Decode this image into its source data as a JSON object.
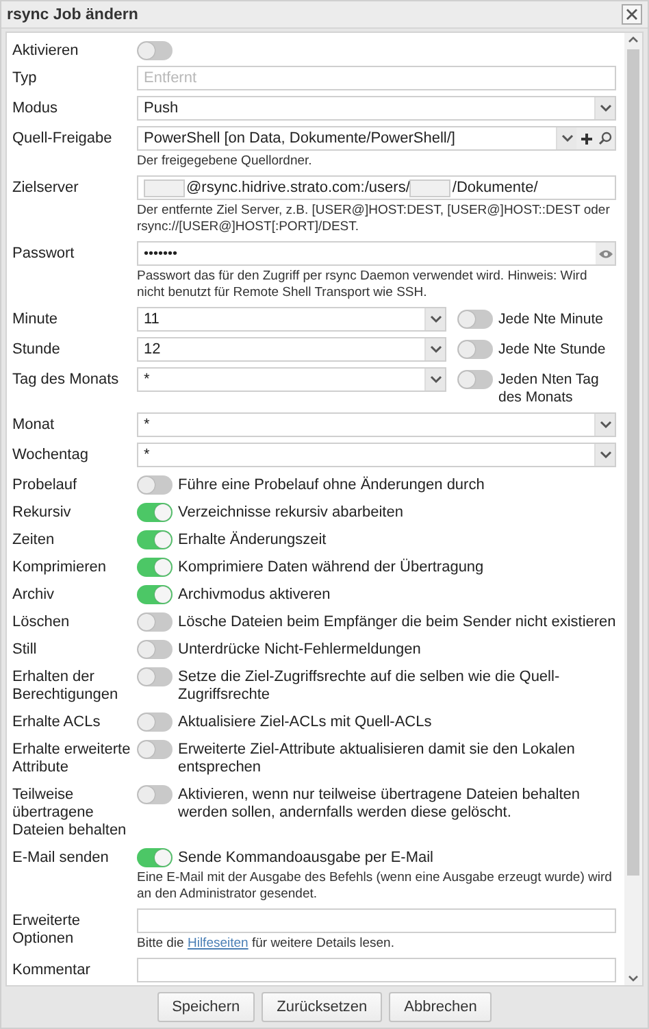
{
  "window": {
    "title": "rsync Job ändern"
  },
  "fields": [
    {
      "label": "Aktivieren",
      "kind": "toggle",
      "on": false
    },
    {
      "label": "Typ",
      "kind": "text",
      "placeholder": "Entfernt"
    },
    {
      "label": "Modus",
      "kind": "select",
      "value": "Push"
    },
    {
      "label": "Quell-Freigabe",
      "kind": "select",
      "value": "PowerShell [on Data, Dokumente/PowerShell/]",
      "add_button": true,
      "search_button": true,
      "hint": "Der freigegebene Quellordner."
    },
    {
      "label": "Zielserver",
      "kind": "segments",
      "segments": [
        {
          "kind": "redacted"
        },
        {
          "kind": "text",
          "text": "@rsync.hidrive.strato.com:/users/"
        },
        {
          "kind": "redacted"
        },
        {
          "kind": "text",
          "text": "/Dokumente/"
        }
      ],
      "hint": "Der entfernte Ziel Server, z.B. [USER@]HOST:DEST, [USER@]HOST::DEST oder rsync://[USER@]HOST[:PORT]/DEST."
    },
    {
      "label": "Passwort",
      "kind": "password",
      "value": "•••••••",
      "hint": "Passwort das für den Zugriff per rsync Daemon verwendet wird. Hinweis: Wird nicht benutzt für Remote Shell Transport wie SSH."
    },
    {
      "label": "Minute",
      "kind": "select_toggle",
      "value": "11",
      "on": false,
      "text": "Jede Nte Minute"
    },
    {
      "label": "Stunde",
      "kind": "select_toggle",
      "value": "12",
      "on": false,
      "text": "Jede Nte Stunde"
    },
    {
      "label": "Tag des Monats",
      "kind": "select_toggle",
      "value": "*",
      "on": false,
      "text": "Jeden Nten Tag des Monats"
    },
    {
      "label": "Monat",
      "kind": "select",
      "value": "*"
    },
    {
      "label": "Wochentag",
      "kind": "select",
      "value": "*"
    },
    {
      "label": "Probelauf",
      "kind": "toggle",
      "on": false,
      "text": "Führe eine Probelauf ohne Änderungen durch"
    },
    {
      "label": "Rekursiv",
      "kind": "toggle",
      "on": true,
      "text": "Verzeichnisse rekursiv abarbeiten"
    },
    {
      "label": "Zeiten",
      "kind": "toggle",
      "on": true,
      "text": "Erhalte Änderungszeit"
    },
    {
      "label": "Komprimieren",
      "kind": "toggle",
      "on": true,
      "text": "Komprimiere Daten während der Übertragung"
    },
    {
      "label": "Archiv",
      "kind": "toggle",
      "on": true,
      "text": "Archivmodus aktiveren"
    },
    {
      "label": "Löschen",
      "kind": "toggle",
      "on": false,
      "text": "Lösche Dateien beim Empfänger die beim Sender nicht existieren"
    },
    {
      "label": "Still",
      "kind": "toggle",
      "on": false,
      "text": "Unterdrücke Nicht-Fehlermeldungen"
    },
    {
      "label": "Erhalten der Berechtigungen",
      "kind": "toggle",
      "on": false,
      "text": "Setze die Ziel-Zugriffsrechte auf die selben wie die Quell-Zugriffsrechte"
    },
    {
      "label": "Erhalte ACLs",
      "kind": "toggle",
      "on": false,
      "text": "Aktualisiere Ziel-ACLs mit Quell-ACLs"
    },
    {
      "label": "Erhalte erweiterte Attribute",
      "kind": "toggle",
      "on": false,
      "text": "Erweiterte Ziel-Attribute aktualisieren damit sie den Lokalen entsprechen"
    },
    {
      "label": "Teilweise übertragene Dateien behalten",
      "kind": "toggle",
      "on": false,
      "text": "Aktivieren, wenn nur teilweise übertragene Dateien behalten werden sollen, andernfalls werden diese gelöscht."
    },
    {
      "label": "E-Mail senden",
      "kind": "toggle",
      "on": true,
      "text": "Sende Kommandoausgabe per E-Mail",
      "hint": "Eine E-Mail mit der Ausgabe des Befehls (wenn eine Ausgabe erzeugt wurde) wird an den Administrator gesendet."
    },
    {
      "label": "Erweiterte Optionen",
      "kind": "text",
      "hint_link": {
        "before": "Bitte die ",
        "link": "Hilfeseiten",
        "after": " für weitere Details lesen."
      }
    },
    {
      "label": "Kommentar",
      "kind": "text"
    }
  ],
  "buttons": [
    "Speichern",
    "Zurücksetzen",
    "Abbrechen"
  ]
}
